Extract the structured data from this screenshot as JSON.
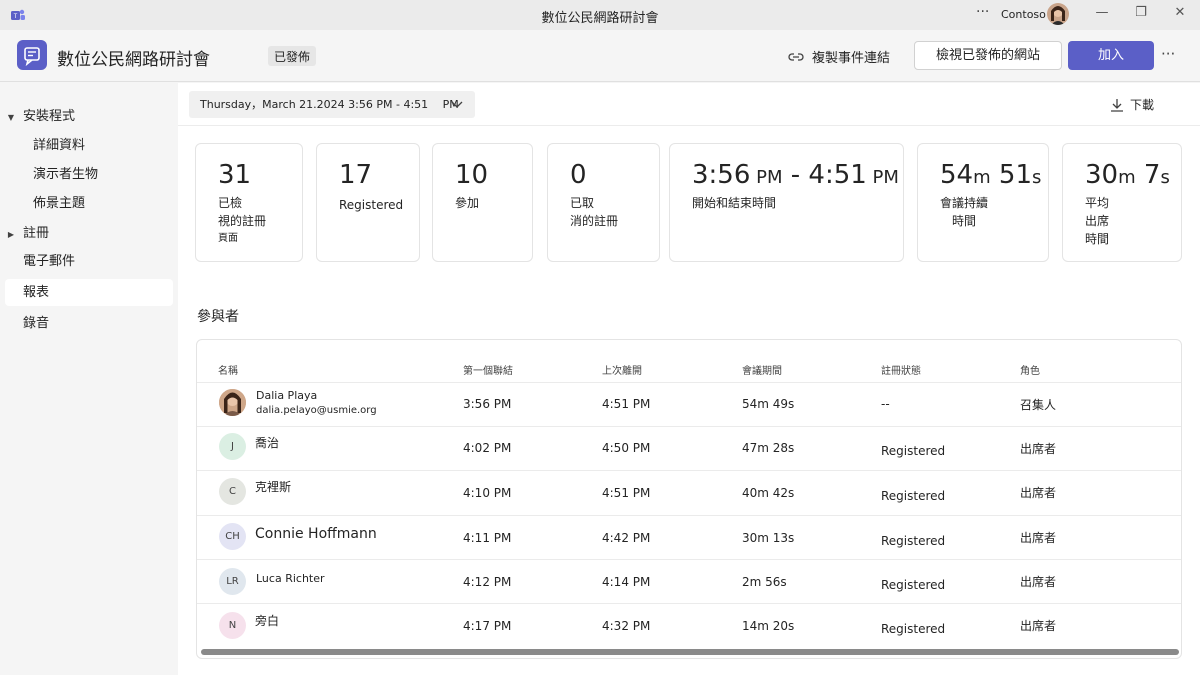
{
  "window": {
    "title": "數位公民網路研討會",
    "org": "Contoso",
    "more_icon": "more-horizontal-icon",
    "minimize_glyph": "—",
    "maximize_glyph": "❐",
    "close_glyph": "✕"
  },
  "header": {
    "event_title": "數位公民網路研討會",
    "status_badge": "已發佈",
    "copy_link_label": "複製事件連結",
    "view_site_label": "檢視已發佈的網站",
    "join_label": "加入",
    "more_label": "···",
    "accent": "#5b5fc7"
  },
  "sidebar": {
    "items": [
      {
        "label": "安裝程式",
        "type": "group",
        "caret": "▼"
      },
      {
        "label": "詳細資料",
        "type": "child"
      },
      {
        "label": "演示者生物",
        "type": "child"
      },
      {
        "label": "佈景主題",
        "type": "child"
      },
      {
        "label": "註冊",
        "type": "group",
        "caret": "▶"
      },
      {
        "label": "電子郵件",
        "type": "item"
      },
      {
        "label": "報表",
        "type": "item",
        "active": true
      },
      {
        "label": "錄音",
        "type": "item"
      }
    ]
  },
  "toolbar": {
    "date_range": "Thursday，March 21.2024 3:56 PM - 4:51　 PM",
    "download_label": "下載"
  },
  "stats": [
    {
      "value": "31",
      "label_lines": [
        "已檢",
        "視的註冊",
        "頁面"
      ]
    },
    {
      "value": "17",
      "label_lines": [
        "Registered"
      ]
    },
    {
      "value": "10",
      "label_lines": [
        "參加"
      ]
    },
    {
      "value": "0",
      "label_lines": [
        "已取",
        "消的註冊"
      ]
    },
    {
      "value_parts": [
        "3:56",
        " PM",
        " - 4:51",
        " PM"
      ],
      "label_lines": [
        "開始和結束時間"
      ]
    },
    {
      "value_parts": [
        "54",
        "m",
        " 51",
        "s"
      ],
      "label_lines": [
        "會議持續",
        "　時間"
      ]
    },
    {
      "value_parts": [
        "30",
        "m",
        " 7",
        "s"
      ],
      "label_lines": [
        "平均",
        "出席",
        "時間"
      ]
    }
  ],
  "participants": {
    "section_title": "參與者",
    "columns": [
      "名稱",
      "第一個聯結",
      "上次離開",
      "會議期間",
      "註冊狀態",
      "角色"
    ],
    "rows": [
      {
        "name": "Dalia Playa",
        "email": "dalia.pelayo@usmie.org",
        "initials": "",
        "avatar": "photo",
        "first_join": "3:56 PM",
        "last_leave": "4:51 PM",
        "duration": "54m 49s",
        "reg_status": "--",
        "role": "召集人"
      },
      {
        "name": "喬治",
        "initials": "J",
        "avatar_color": "#dbefe3",
        "first_join": "4:02 PM",
        "last_leave": "4:50 PM",
        "duration": "47m 28s",
        "reg_status": "Registered",
        "role": "出席者"
      },
      {
        "name": "克裡斯",
        "initials": "C",
        "avatar_color": "#e4e6e1",
        "first_join": "4:10 PM",
        "last_leave": "4:51 PM",
        "duration": "40m 42s",
        "reg_status": "Registered",
        "role": "出席者"
      },
      {
        "name": "Connie Hoffmann",
        "initials": "CH",
        "avatar_color": "#e3e4f4",
        "first_join": "4:11 PM",
        "last_leave": "4:42 PM",
        "duration": "30m 13s",
        "reg_status": "Registered",
        "role": "出席者"
      },
      {
        "name": "Luca Richter",
        "initials": "LR",
        "avatar_color": "#e0e7ee",
        "first_join": "4:12 PM",
        "last_leave": "4:14 PM",
        "duration": "2m 56s",
        "reg_status": "Registered",
        "role": "出席者"
      },
      {
        "name": "旁白",
        "initials": "N",
        "avatar_color": "#f6e1ec",
        "first_join": "4:17 PM",
        "last_leave": "4:32 PM",
        "duration": "14m 20s",
        "reg_status": "Registered",
        "role": "出席者"
      }
    ]
  }
}
